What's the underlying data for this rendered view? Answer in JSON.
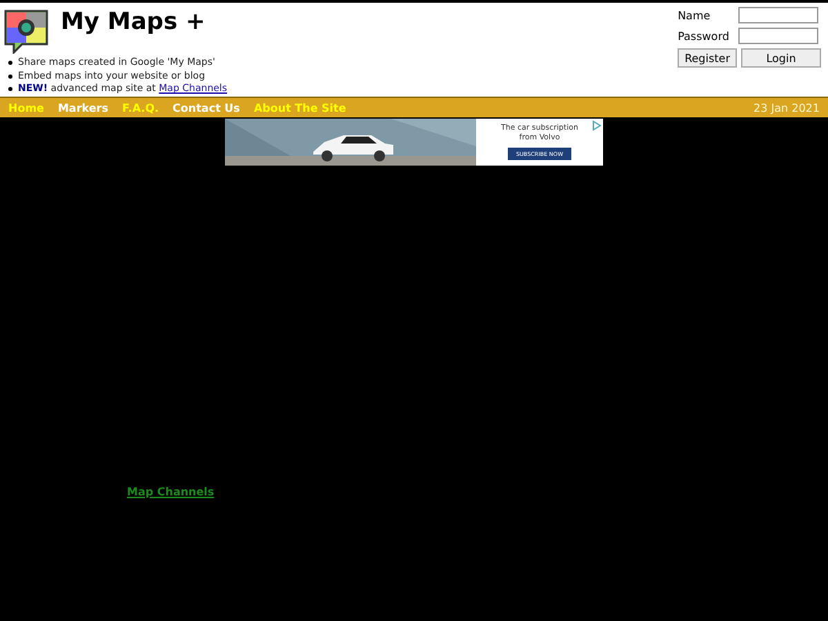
{
  "site": {
    "title": "My Maps +",
    "bullets": [
      {
        "text": "Share maps created in Google 'My Maps'"
      },
      {
        "text": "Embed maps into your website or blog"
      },
      {
        "text": "**NEW!** advanced map site at",
        "link": "Map Channels"
      }
    ]
  },
  "login": {
    "name_label": "Name",
    "password_label": "Password",
    "buttons": [
      "Register",
      "Login"
    ]
  },
  "nav": {
    "items": [
      {
        "label": "Home",
        "color": "#ffff00"
      },
      {
        "label": "Markers",
        "color": "#ffffff"
      },
      {
        "label": "F.A.Q.",
        "color": "#ffff00"
      },
      {
        "label": "Contact Us",
        "color": "#ffffff"
      },
      {
        "label": "About The Site",
        "color": "#ffff00"
      }
    ],
    "date": "23 Jan 2021"
  },
  "ad": {
    "kind": "picture",
    "headline": "The car subscription from Volvo",
    "button": "SUBSCRIBE NOW"
  },
  "body": {
    "link": "Map Channels"
  }
}
